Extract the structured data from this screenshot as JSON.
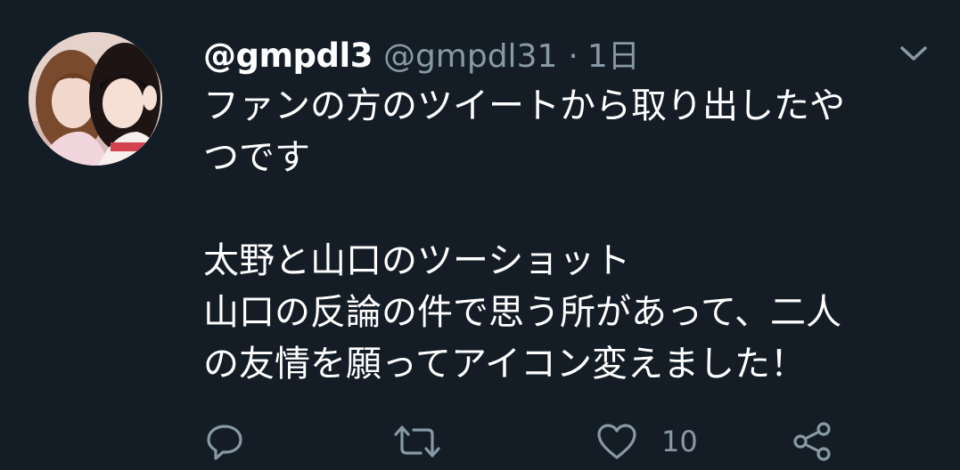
{
  "tweet": {
    "display_name": "@gmpdl3",
    "handle": "@gmpdl31",
    "separator": "·",
    "timestamp": "1日",
    "text_lines": [
      "ファンの方のツイートから取り出したや",
      "つです",
      "",
      "太野と山口のツーショット",
      "山口の反論の件で思う所があって、二人",
      "の友情を願ってアイコン変えました！"
    ],
    "like_count": "10"
  },
  "icons": {
    "caret": "chevron-down-icon",
    "reply": "reply-icon",
    "retweet": "retweet-icon",
    "like": "heart-icon",
    "share": "share-icon"
  },
  "colors": {
    "background": "#141d26",
    "primary_text": "#ffffff",
    "secondary_text": "#8899a6"
  }
}
